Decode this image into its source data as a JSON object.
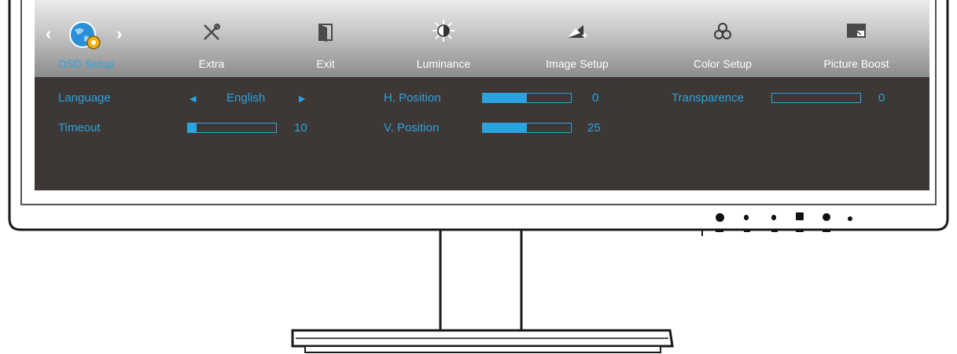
{
  "tabs": [
    {
      "label": "OSD Setup",
      "icon": "globe-gear-icon",
      "active": true
    },
    {
      "label": "Extra",
      "icon": "tools-icon",
      "active": false
    },
    {
      "label": "Exit",
      "icon": "exit-door-icon",
      "active": false
    },
    {
      "label": "Luminance",
      "icon": "sun-icon",
      "active": false
    },
    {
      "label": "Image Setup",
      "icon": "image-setup-icon",
      "active": false
    },
    {
      "label": "Color Setup",
      "icon": "color-circles-icon",
      "active": false
    },
    {
      "label": "Picture Boost",
      "icon": "picture-boost-icon",
      "active": false
    }
  ],
  "settings": {
    "language": {
      "label": "Language",
      "value": "English"
    },
    "timeout": {
      "label": "Timeout",
      "value": "10",
      "level": 0.1
    },
    "h_position": {
      "label": "H. Position",
      "value": "0",
      "level": 0.5
    },
    "v_position": {
      "label": "V. Position",
      "value": "25",
      "level": 0.5
    },
    "transparence": {
      "label": "Transparence",
      "value": "0",
      "level": 0
    }
  },
  "colors": {
    "accent": "#2aa3e0",
    "panel": "#3d3836"
  }
}
